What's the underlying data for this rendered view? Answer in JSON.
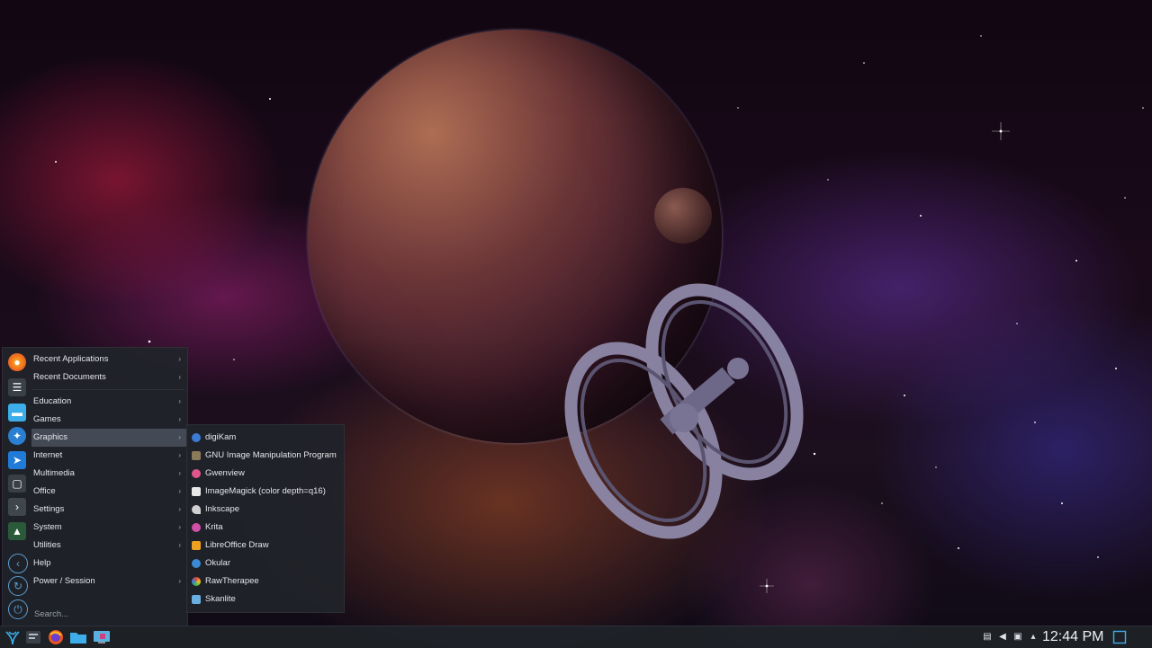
{
  "menu": {
    "top_items": [
      {
        "label": "Recent Applications",
        "has_submenu": true
      },
      {
        "label": "Recent Documents",
        "has_submenu": true
      }
    ],
    "categories": [
      {
        "label": "Education",
        "has_submenu": true
      },
      {
        "label": "Games",
        "has_submenu": true
      },
      {
        "label": "Graphics",
        "has_submenu": true,
        "active": true
      },
      {
        "label": "Internet",
        "has_submenu": true
      },
      {
        "label": "Multimedia",
        "has_submenu": true
      },
      {
        "label": "Office",
        "has_submenu": true
      },
      {
        "label": "Settings",
        "has_submenu": true
      },
      {
        "label": "System",
        "has_submenu": true
      },
      {
        "label": "Utilities",
        "has_submenu": true
      },
      {
        "label": "Help",
        "has_submenu": false
      },
      {
        "label": "Power / Session",
        "has_submenu": true
      }
    ],
    "arrow_glyph": "›",
    "search_placeholder": "Search..."
  },
  "graphics_submenu": [
    {
      "label": "digiKam",
      "icon": "digikam-icon",
      "color": "#3a7bd5"
    },
    {
      "label": "GNU Image Manipulation Program",
      "icon": "gimp-icon",
      "color": "#8a7a5a"
    },
    {
      "label": "Gwenview",
      "icon": "gwenview-icon",
      "color": "#e0558a"
    },
    {
      "label": "ImageMagick (color depth=q16)",
      "icon": "imagemagick-icon",
      "color": "#e8e8e8"
    },
    {
      "label": "Inkscape",
      "icon": "inkscape-icon",
      "color": "#d0d0d0"
    },
    {
      "label": "Krita",
      "icon": "krita-icon",
      "color": "#d24fa8"
    },
    {
      "label": "LibreOffice Draw",
      "icon": "libreoffice-draw-icon",
      "color": "#f0a020"
    },
    {
      "label": "Okular",
      "icon": "okular-icon",
      "color": "#3a8ad5"
    },
    {
      "label": "RawTherapee",
      "icon": "rawtherapee-icon",
      "color": "#e04040"
    },
    {
      "label": "Skanlite",
      "icon": "skanlite-icon",
      "color": "#6aaee0"
    }
  ],
  "taskbar": {
    "clock": "12:44 PM"
  },
  "colors": {
    "panel_bg": "#20242a",
    "accent_blue": "#3daee9"
  }
}
